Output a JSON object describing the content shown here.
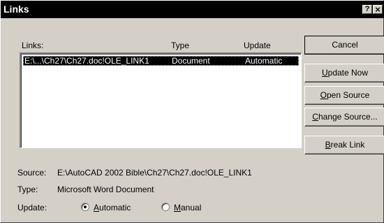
{
  "window": {
    "title": "Links",
    "help_glyph": "?",
    "close_glyph": "×"
  },
  "list": {
    "headers": {
      "links": "Links:",
      "type": "Type",
      "update": "Update"
    },
    "rows": [
      {
        "link": "E:\\...\\Ch27\\Ch27.doc!OLE_LINK1",
        "type": "Document",
        "update": "Automatic",
        "selected": true
      }
    ]
  },
  "buttons": {
    "cancel": "Cancel",
    "update_now": {
      "mn": "U",
      "rest": "pdate Now"
    },
    "open_source": {
      "mn": "O",
      "rest": "pen Source"
    },
    "change_source": {
      "mn": "C",
      "rest": "hange Source..."
    },
    "break_link": {
      "mn": "B",
      "rest": "reak Link"
    }
  },
  "details": {
    "source_label": "Source:",
    "source_value": "E:\\AutoCAD 2002 Bible\\Ch27\\Ch27.doc!OLE_LINK1",
    "type_label": "Type:",
    "type_value": "Microsoft Word Document",
    "update_label": "Update:",
    "automatic": {
      "mn": "A",
      "rest": "utomatic",
      "checked": true
    },
    "manual": {
      "mn": "M",
      "rest": "anual",
      "checked": false
    }
  }
}
